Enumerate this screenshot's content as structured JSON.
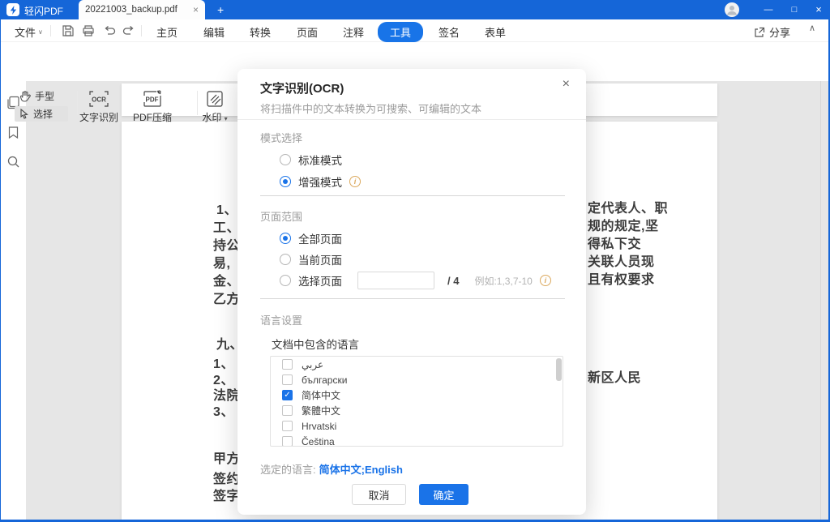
{
  "colors": {
    "titlebar": "#1566d8",
    "accent": "#1a73e8",
    "canvas": "#e6e6e6",
    "info_orange": "#dba85c"
  },
  "titlebar": {
    "app_name": "轻闪PDF",
    "tab_title": "20221003_backup.pdf",
    "tab_close": "×",
    "new_tab": "+",
    "minimize": "—",
    "maximize": "□",
    "close": "×"
  },
  "menubar": {
    "file_label": "文件",
    "file_caret": "∨",
    "tabs": [
      {
        "label": "主页",
        "active": false
      },
      {
        "label": "编辑",
        "active": false
      },
      {
        "label": "转换",
        "active": false
      },
      {
        "label": "页面",
        "active": false
      },
      {
        "label": "注释",
        "active": false
      },
      {
        "label": "工具",
        "active": true
      },
      {
        "label": "签名",
        "active": false
      },
      {
        "label": "表单",
        "active": false
      }
    ],
    "share_label": "分享",
    "collapse": "∧"
  },
  "toolbar": {
    "hand_label": "手型",
    "select_label": "选择",
    "ocr_label": "文字识别",
    "ocr_icon_text": "OCR",
    "compress_label": "PDF压缩",
    "pdf_icon_text": "PDF",
    "watermark_label": "水印",
    "watermark_caret": "▾"
  },
  "document": {
    "left_fragments": [
      "1、",
      "工、",
      "持公",
      "易,",
      "金、",
      "乙方"
    ],
    "right_fragments": [
      "定代表人、职",
      "规的规定,坚",
      "得私下交",
      "关联人员现",
      "且有权要求"
    ],
    "right_fragment_lower": "新区人民",
    "lower_fragments": [
      {
        "text": "九、",
        "bold": true
      },
      {
        "text": "1、",
        "bold": false
      },
      {
        "text": "2、",
        "bold": false
      },
      {
        "text": "法院",
        "bold": false
      },
      {
        "text": "3、",
        "bold": false
      },
      {
        "text": "甲方",
        "bold": true
      },
      {
        "text": "签约",
        "bold": true
      },
      {
        "text": "签字",
        "bold": true
      }
    ]
  },
  "dialog": {
    "title": "文字识别(OCR)",
    "subtitle": "将扫描件中的文本转换为可搜索、可编辑的文本",
    "close": "×",
    "mode": {
      "label": "模式选择",
      "standard": "标准模式",
      "standard_selected": false,
      "enhanced": "增强模式",
      "enhanced_selected": true,
      "enhanced_info": "i"
    },
    "range": {
      "label": "页面范围",
      "all": "全部页面",
      "all_selected": true,
      "current": "当前页面",
      "select": "选择页面",
      "input_value": "",
      "total": "/ 4",
      "example": "例如:1,3,7-10",
      "info": "i"
    },
    "language": {
      "label": "语言设置",
      "sublabel": "文档中包含的语言",
      "options": [
        {
          "label": "عربي",
          "checked": false
        },
        {
          "label": "български",
          "checked": false
        },
        {
          "label": "简体中文",
          "checked": true
        },
        {
          "label": "繁體中文",
          "checked": false
        },
        {
          "label": "Hrvatski",
          "checked": false
        },
        {
          "label": "Čeština",
          "checked": false
        }
      ],
      "check_glyph": "✓",
      "selected_label": "选定的语言:",
      "selected_value": "简体中文;English"
    },
    "cancel": "取消",
    "confirm": "确定"
  }
}
